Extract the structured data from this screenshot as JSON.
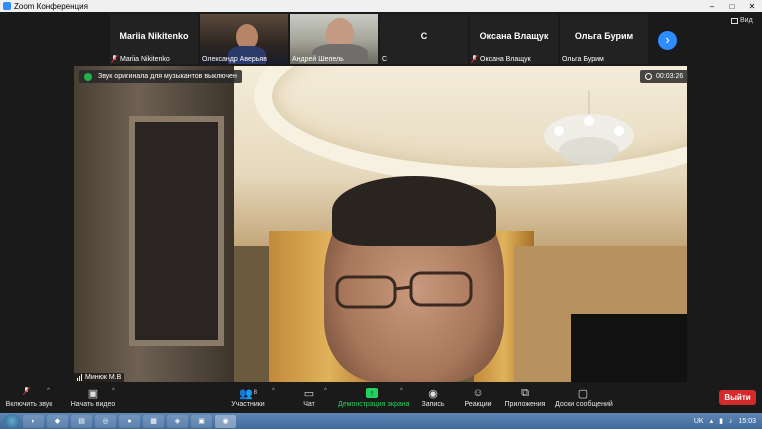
{
  "window": {
    "title": "Zoom Конференция"
  },
  "gallery": {
    "tiles": [
      {
        "big_name": "Mariia Nikitenko",
        "label": "Mariia Nikitenko",
        "muted": true
      },
      {
        "big_name": "",
        "label": "Олександр Аверьяв",
        "muted": false
      },
      {
        "big_name": "",
        "label": "Андрей Шепель",
        "muted": false
      },
      {
        "big_name": "С",
        "label": "С",
        "muted": false
      },
      {
        "big_name": "Оксана Влащук",
        "label": "Оксана Влащук",
        "muted": true
      },
      {
        "big_name": "Ольга Бурим",
        "label": "Ольга Бурим",
        "muted": false
      }
    ],
    "next_icon": "chevron-right-icon",
    "view_label": "Вид"
  },
  "main_video": {
    "original_sound_notice": "Звук оригинала для музыкантов выключен",
    "timer": "00:03:26",
    "speaker_name": "Минюк М.В"
  },
  "toolbar": {
    "unmute": "Включить звук",
    "start_video": "Начать видео",
    "participants": "Участники",
    "participants_count": "8",
    "chat": "Чат",
    "share": "Демонстрация экрана",
    "record": "Запись",
    "reactions": "Реакции",
    "apps": "Приложения",
    "whiteboards": "Доски сообщений",
    "end": "Выйти"
  },
  "taskbar": {
    "lang": "UK",
    "time": "15:03"
  },
  "colors": {
    "accent": "#2d8cff",
    "share_green": "#23d160",
    "end_red": "#d32b2b",
    "mute_red": "#e02828"
  }
}
